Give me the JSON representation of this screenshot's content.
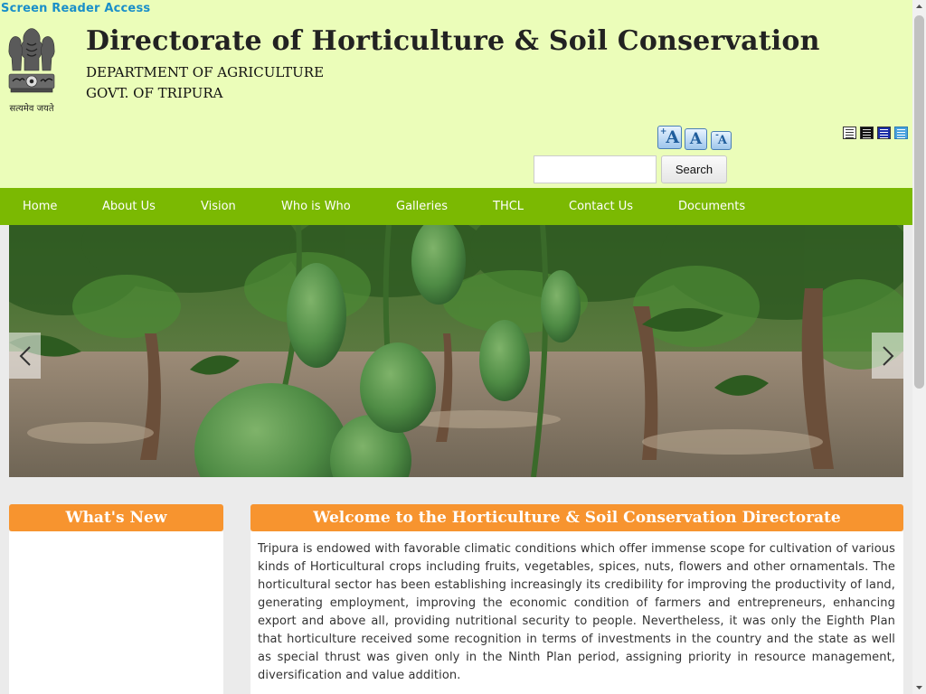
{
  "header": {
    "screen_reader_label": "Screen Reader Access",
    "title": "Directorate of Horticulture & Soil Conservation",
    "department": "DEPARTMENT OF AGRICULTURE",
    "govt": "GOVT. OF TRIPURA",
    "emblem_motto": "सत्यमेव जयते"
  },
  "accessibility": {
    "font_increase_label": "A",
    "font_increase_prefix": "+",
    "font_normal_label": "A",
    "font_decrease_label": "A",
    "font_decrease_prefix": "-",
    "themes": [
      {
        "name": "theme-white-icon",
        "color": "#ffffff"
      },
      {
        "name": "theme-black-icon",
        "color": "#111111"
      },
      {
        "name": "theme-blue-icon",
        "color": "#1a2ea8"
      },
      {
        "name": "theme-lightblue-icon",
        "color": "#4aa3df"
      }
    ]
  },
  "search": {
    "value": "",
    "placeholder": "",
    "button_label": "Search"
  },
  "nav": {
    "items": [
      "Home",
      "About Us",
      "Vision",
      "Who is Who",
      "Galleries",
      "THCL",
      "Contact Us",
      "Documents"
    ]
  },
  "slider": {
    "prev_icon": "chevron-left-icon",
    "next_icon": "chevron-right-icon"
  },
  "whats_new": {
    "title": "What's New"
  },
  "welcome": {
    "title": "Welcome to the Horticulture & Soil Conservation Directorate",
    "text": "Tripura is endowed with favorable climatic conditions which offer immense scope for cultivation of various kinds of Horticultural crops including fruits, vegetables, spices, nuts, flowers and other ornamentals. The horticultural sector has been establishing increasingly its credibility for improving the productivity of land, generating employment, improving the economic condition of farmers and entrepreneurs, enhancing export and above all, providing nutritional security to people. Nevertheless, it was only the Eighth Plan that horticulture received some recognition in terms of investments in the country and the state as well as special thrust was given only in the Ninth Plan period, assigning priority in resource management, diversification and value addition."
  },
  "colors": {
    "header_bg": "#ebfdb9",
    "nav_bg": "#7bb902",
    "box_header_bg": "#f7942f",
    "link_blue": "#1a8fc9"
  }
}
